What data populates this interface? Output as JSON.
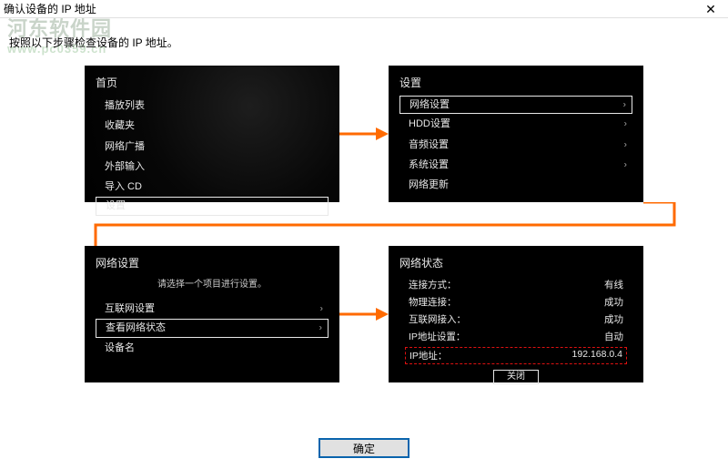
{
  "window": {
    "title": "确认设备的 IP 地址",
    "close_glyph": "✕"
  },
  "watermark": {
    "line1": "河东软件园",
    "line2": "www.pc0359.cn"
  },
  "instruction": "按照以下步骤检查设备的 IP 地址。",
  "panel1": {
    "title": "首页",
    "items": [
      "播放列表",
      "收藏夹",
      "网络广播",
      "外部输入",
      "导入 CD",
      "设置"
    ],
    "selected_index": 5
  },
  "panel2": {
    "title": "设置",
    "items": [
      "网络设置",
      "HDD设置",
      "音频设置",
      "系统设置",
      "网络更新"
    ],
    "selected_index": 0
  },
  "panel3": {
    "title": "网络设置",
    "hint": "请选择一个项目进行设置。",
    "items": [
      "互联网设置",
      "查看网络状态",
      "设备名"
    ],
    "selected_index": 1
  },
  "panel4": {
    "title": "网络状态",
    "rows": [
      {
        "label": "连接方式：",
        "value": "有线"
      },
      {
        "label": "物理连接：",
        "value": "成功"
      },
      {
        "label": "互联网接入：",
        "value": "成功"
      },
      {
        "label": "IP地址设置：",
        "value": "自动"
      }
    ],
    "ip_row": {
      "label": "IP地址：",
      "value": "192.168.0.4"
    },
    "close_label": "关闭"
  },
  "ok_button": "确定",
  "colors": {
    "arrow": "#ff6a00",
    "highlight_dash": "#dd1111",
    "ok_border": "#0a64ad"
  }
}
